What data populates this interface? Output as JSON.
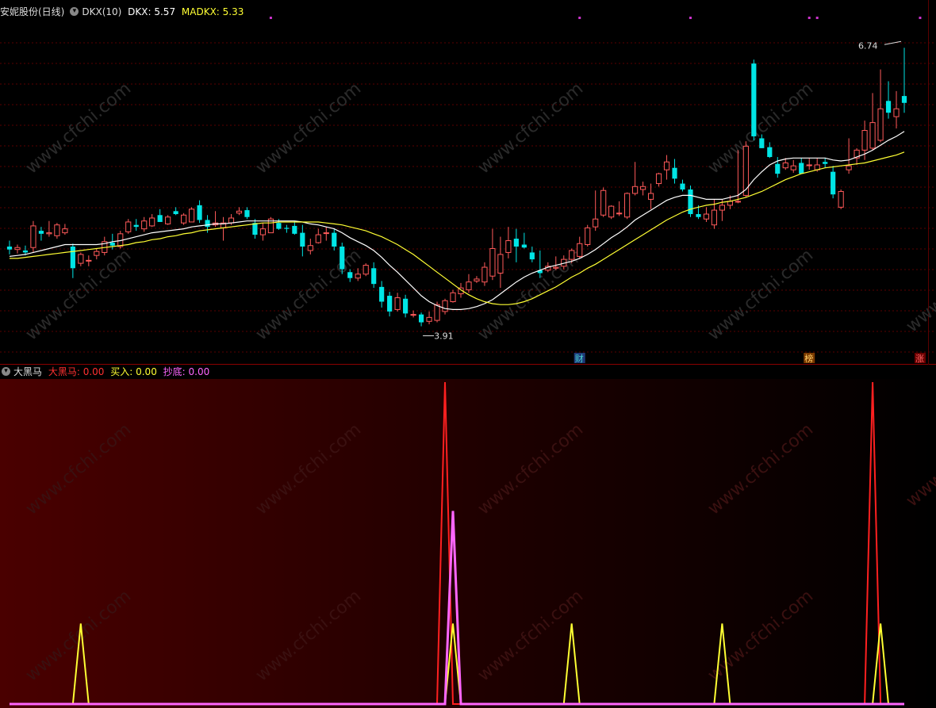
{
  "colors": {
    "up": "#ff5a5a",
    "down": "#00e5e5",
    "dkx": "#ffffff",
    "madkx": "#ffff33",
    "dahei": "#ff2020",
    "buy": "#ffff33",
    "chaodi": "#ff66ff",
    "grid": "#5a0000",
    "cyan_text": "#48d1cc"
  },
  "main_header": {
    "stock_name": "安妮股份(日线)",
    "indicator": "DKX(10)",
    "dkx_label": "DKX: 5.57",
    "madkx_label": "MADKX: 5.33"
  },
  "annotations": {
    "high": "6.74",
    "low": "3.91",
    "marker_cai": "财",
    "marker_bang": "榜",
    "marker_zhang": "涨"
  },
  "sub_header": {
    "name": "大黑马",
    "dahei_label": "大黑马: 0.00",
    "buy_label": "买入: 0.00",
    "chaodi_label": "抄底: 0.00"
  },
  "watermark": "www.cfchi.com",
  "chart_data": [
    {
      "type": "candlestick",
      "ylim": [
        3.6,
        7.0
      ],
      "candles": [
        [
          4.72,
          4.78,
          4.64,
          4.69
        ],
        [
          4.69,
          4.74,
          4.65,
          4.71
        ],
        [
          4.68,
          4.73,
          4.63,
          4.66
        ],
        [
          4.71,
          4.98,
          4.66,
          4.93
        ],
        [
          4.88,
          4.92,
          4.78,
          4.85
        ],
        [
          4.85,
          4.98,
          4.82,
          4.86
        ],
        [
          4.83,
          4.96,
          4.8,
          4.94
        ],
        [
          4.86,
          4.95,
          4.84,
          4.9
        ],
        [
          4.72,
          4.75,
          4.4,
          4.5
        ],
        [
          4.55,
          4.66,
          4.52,
          4.64
        ],
        [
          4.58,
          4.63,
          4.52,
          4.58
        ],
        [
          4.63,
          4.7,
          4.59,
          4.67
        ],
        [
          4.66,
          4.82,
          4.63,
          4.77
        ],
        [
          4.76,
          4.85,
          4.69,
          4.73
        ],
        [
          4.72,
          4.88,
          4.7,
          4.85
        ],
        [
          4.87,
          5.0,
          4.85,
          4.97
        ],
        [
          4.94,
          5.0,
          4.88,
          4.92
        ],
        [
          4.9,
          5.02,
          4.87,
          4.98
        ],
        [
          4.93,
          5.05,
          4.92,
          5.01
        ],
        [
          5.04,
          5.1,
          4.97,
          4.97
        ],
        [
          4.95,
          5.04,
          4.94,
          5.02
        ],
        [
          5.08,
          5.12,
          5.04,
          5.05
        ],
        [
          4.96,
          5.06,
          4.94,
          5.04
        ],
        [
          4.97,
          5.12,
          4.97,
          5.1
        ],
        [
          5.14,
          5.19,
          4.96,
          4.99
        ],
        [
          4.99,
          5.04,
          4.86,
          4.92
        ],
        [
          4.94,
          5.08,
          4.92,
          4.96
        ],
        [
          4.91,
          5.02,
          4.78,
          4.96
        ],
        [
          4.96,
          5.05,
          4.94,
          5.01
        ],
        [
          5.06,
          5.12,
          5.04,
          5.08
        ],
        [
          5.09,
          5.12,
          5.0,
          5.02
        ],
        [
          4.96,
          5.0,
          4.8,
          4.84
        ],
        [
          4.84,
          4.96,
          4.78,
          4.9
        ],
        [
          4.86,
          5.02,
          4.86,
          5.0
        ],
        [
          4.96,
          5.0,
          4.89,
          4.9
        ],
        [
          4.91,
          4.94,
          4.86,
          4.9
        ],
        [
          4.93,
          4.98,
          4.84,
          4.85
        ],
        [
          4.86,
          4.94,
          4.62,
          4.72
        ],
        [
          4.68,
          4.8,
          4.64,
          4.73
        ],
        [
          4.76,
          4.9,
          4.75,
          4.84
        ],
        [
          4.86,
          4.92,
          4.78,
          4.86
        ],
        [
          4.86,
          4.9,
          4.68,
          4.72
        ],
        [
          4.72,
          4.76,
          4.44,
          4.49
        ],
        [
          4.46,
          4.49,
          4.36,
          4.4
        ],
        [
          4.4,
          4.5,
          4.37,
          4.44
        ],
        [
          4.44,
          4.55,
          4.42,
          4.53
        ],
        [
          4.5,
          4.56,
          4.3,
          4.34
        ],
        [
          4.31,
          4.37,
          4.1,
          4.16
        ],
        [
          4.22,
          4.26,
          4.01,
          4.06
        ],
        [
          4.08,
          4.25,
          4.06,
          4.2
        ],
        [
          4.19,
          4.23,
          4.0,
          4.04
        ],
        [
          4.03,
          4.07,
          4.0,
          4.03
        ],
        [
          4.03,
          4.05,
          3.91,
          3.95
        ],
        [
          3.96,
          4.06,
          3.93,
          4.0
        ],
        [
          3.97,
          4.16,
          3.95,
          4.13
        ],
        [
          4.06,
          4.19,
          4.03,
          4.17
        ],
        [
          4.16,
          4.28,
          4.15,
          4.25
        ],
        [
          4.24,
          4.35,
          4.2,
          4.3
        ],
        [
          4.28,
          4.44,
          4.25,
          4.36
        ],
        [
          4.37,
          4.42,
          4.35,
          4.39
        ],
        [
          4.36,
          4.56,
          4.32,
          4.51
        ],
        [
          4.42,
          4.9,
          4.38,
          4.7
        ],
        [
          4.45,
          4.82,
          4.3,
          4.64
        ],
        [
          4.66,
          4.92,
          4.6,
          4.78
        ],
        [
          4.8,
          4.9,
          4.56,
          4.72
        ],
        [
          4.74,
          4.86,
          4.7,
          4.71
        ],
        [
          4.66,
          4.72,
          4.56,
          4.59
        ],
        [
          4.48,
          4.68,
          4.4,
          4.45
        ],
        [
          4.48,
          4.56,
          4.46,
          4.52
        ],
        [
          4.5,
          4.62,
          4.48,
          4.51
        ],
        [
          4.52,
          4.63,
          4.49,
          4.59
        ],
        [
          4.59,
          4.7,
          4.55,
          4.68
        ],
        [
          4.62,
          4.82,
          4.6,
          4.75
        ],
        [
          4.74,
          4.94,
          4.72,
          4.91
        ],
        [
          4.92,
          5.29,
          4.88,
          5.0
        ],
        [
          5.04,
          5.32,
          5.02,
          5.29
        ],
        [
          5.02,
          5.14,
          5.0,
          5.13
        ],
        [
          5.06,
          5.18,
          5.03,
          5.06
        ],
        [
          5.02,
          5.27,
          5.0,
          5.26
        ],
        [
          5.26,
          5.58,
          5.24,
          5.33
        ],
        [
          5.3,
          5.38,
          5.24,
          5.33
        ],
        [
          5.2,
          5.36,
          5.1,
          5.26
        ],
        [
          5.36,
          5.47,
          5.33,
          5.46
        ],
        [
          5.5,
          5.65,
          5.4,
          5.58
        ],
        [
          5.52,
          5.61,
          5.36,
          5.41
        ],
        [
          5.36,
          5.4,
          5.28,
          5.3
        ],
        [
          5.3,
          5.34,
          5.02,
          5.05
        ],
        [
          5.05,
          5.14,
          5.0,
          5.02
        ],
        [
          5.0,
          5.12,
          4.97,
          5.05
        ],
        [
          4.94,
          5.2,
          4.9,
          5.09
        ],
        [
          5.09,
          5.2,
          4.98,
          5.14
        ],
        [
          5.14,
          5.24,
          5.1,
          5.18
        ],
        [
          5.18,
          5.7,
          5.16,
          5.18
        ],
        [
          5.24,
          5.79,
          5.22,
          5.74
        ],
        [
          6.58,
          6.62,
          5.8,
          5.84
        ],
        [
          5.82,
          5.86,
          5.72,
          5.72
        ],
        [
          5.73,
          5.78,
          5.62,
          5.63
        ],
        [
          5.56,
          5.63,
          5.42,
          5.46
        ],
        [
          5.52,
          5.62,
          5.5,
          5.57
        ],
        [
          5.5,
          5.6,
          5.47,
          5.54
        ],
        [
          5.57,
          5.62,
          5.46,
          5.46
        ],
        [
          5.55,
          5.62,
          5.5,
          5.55
        ],
        [
          5.5,
          5.62,
          5.48,
          5.55
        ],
        [
          5.58,
          5.62,
          5.52,
          5.56
        ],
        [
          5.48,
          5.54,
          5.21,
          5.25
        ],
        [
          5.12,
          5.3,
          5.1,
          5.28
        ],
        [
          5.5,
          5.82,
          5.46,
          5.54
        ],
        [
          5.62,
          5.72,
          5.55,
          5.7
        ],
        [
          5.7,
          6.0,
          5.6,
          5.9
        ],
        [
          5.72,
          6.28,
          5.7,
          5.98
        ],
        [
          5.8,
          6.52,
          5.78,
          6.12
        ],
        [
          6.2,
          6.4,
          6.02,
          6.08
        ],
        [
          6.04,
          6.3,
          5.92,
          6.12
        ],
        [
          6.25,
          6.74,
          6.08,
          6.18
        ]
      ],
      "series": [
        {
          "name": "DKX",
          "values": [
            4.62,
            4.63,
            4.64,
            4.66,
            4.68,
            4.7,
            4.72,
            4.74,
            4.74,
            4.74,
            4.74,
            4.74,
            4.75,
            4.77,
            4.78,
            4.8,
            4.82,
            4.84,
            4.86,
            4.87,
            4.88,
            4.89,
            4.9,
            4.92,
            4.93,
            4.94,
            4.95,
            4.95,
            4.96,
            4.97,
            4.98,
            4.98,
            4.98,
            4.98,
            4.98,
            4.98,
            4.98,
            4.97,
            4.95,
            4.94,
            4.92,
            4.9,
            4.86,
            4.81,
            4.77,
            4.73,
            4.68,
            4.61,
            4.53,
            4.46,
            4.38,
            4.3,
            4.22,
            4.16,
            4.12,
            4.09,
            4.08,
            4.08,
            4.09,
            4.11,
            4.14,
            4.18,
            4.24,
            4.3,
            4.36,
            4.41,
            4.45,
            4.48,
            4.51,
            4.53,
            4.55,
            4.57,
            4.6,
            4.64,
            4.69,
            4.75,
            4.81,
            4.86,
            4.92,
            4.99,
            5.04,
            5.09,
            5.14,
            5.19,
            5.22,
            5.24,
            5.24,
            5.22,
            5.2,
            5.2,
            5.2,
            5.22,
            5.24,
            5.3,
            5.4,
            5.48,
            5.55,
            5.59,
            5.61,
            5.62,
            5.62,
            5.62,
            5.62,
            5.62,
            5.6,
            5.59,
            5.6,
            5.63,
            5.66,
            5.7,
            5.75,
            5.8,
            5.84,
            5.89
          ]
        },
        {
          "name": "MADKX",
          "values": [
            4.6,
            4.6,
            4.61,
            4.62,
            4.63,
            4.64,
            4.65,
            4.66,
            4.67,
            4.68,
            4.69,
            4.7,
            4.71,
            4.72,
            4.73,
            4.74,
            4.76,
            4.77,
            4.79,
            4.8,
            4.82,
            4.83,
            4.85,
            4.86,
            4.88,
            4.89,
            4.9,
            4.91,
            4.92,
            4.93,
            4.94,
            4.95,
            4.96,
            4.96,
            4.97,
            4.97,
            4.97,
            4.97,
            4.97,
            4.97,
            4.96,
            4.95,
            4.94,
            4.92,
            4.9,
            4.88,
            4.85,
            4.82,
            4.78,
            4.74,
            4.69,
            4.64,
            4.58,
            4.52,
            4.46,
            4.4,
            4.34,
            4.28,
            4.23,
            4.19,
            4.16,
            4.14,
            4.13,
            4.13,
            4.14,
            4.16,
            4.19,
            4.23,
            4.27,
            4.31,
            4.36,
            4.41,
            4.45,
            4.5,
            4.54,
            4.59,
            4.64,
            4.69,
            4.74,
            4.79,
            4.84,
            4.89,
            4.94,
            4.99,
            5.03,
            5.07,
            5.1,
            5.12,
            5.14,
            5.15,
            5.17,
            5.18,
            5.2,
            5.22,
            5.25,
            5.28,
            5.32,
            5.36,
            5.4,
            5.43,
            5.46,
            5.48,
            5.5,
            5.52,
            5.53,
            5.54,
            5.55,
            5.56,
            5.57,
            5.59,
            5.61,
            5.63,
            5.65,
            5.68
          ]
        }
      ]
    },
    {
      "type": "line",
      "ylim": [
        0,
        1
      ],
      "series": [
        {
          "name": "大黑马",
          "spikes": [
            [
              55,
              1.0
            ],
            [
              109,
              1.0
            ]
          ]
        },
        {
          "name": "买入",
          "spikes": [
            [
              9,
              0.25
            ],
            [
              56,
              0.25
            ],
            [
              71,
              0.25
            ],
            [
              90,
              0.25
            ],
            [
              110,
              0.25
            ]
          ]
        },
        {
          "name": "抄底",
          "spikes": [
            [
              56,
              0.6
            ]
          ]
        }
      ]
    }
  ]
}
